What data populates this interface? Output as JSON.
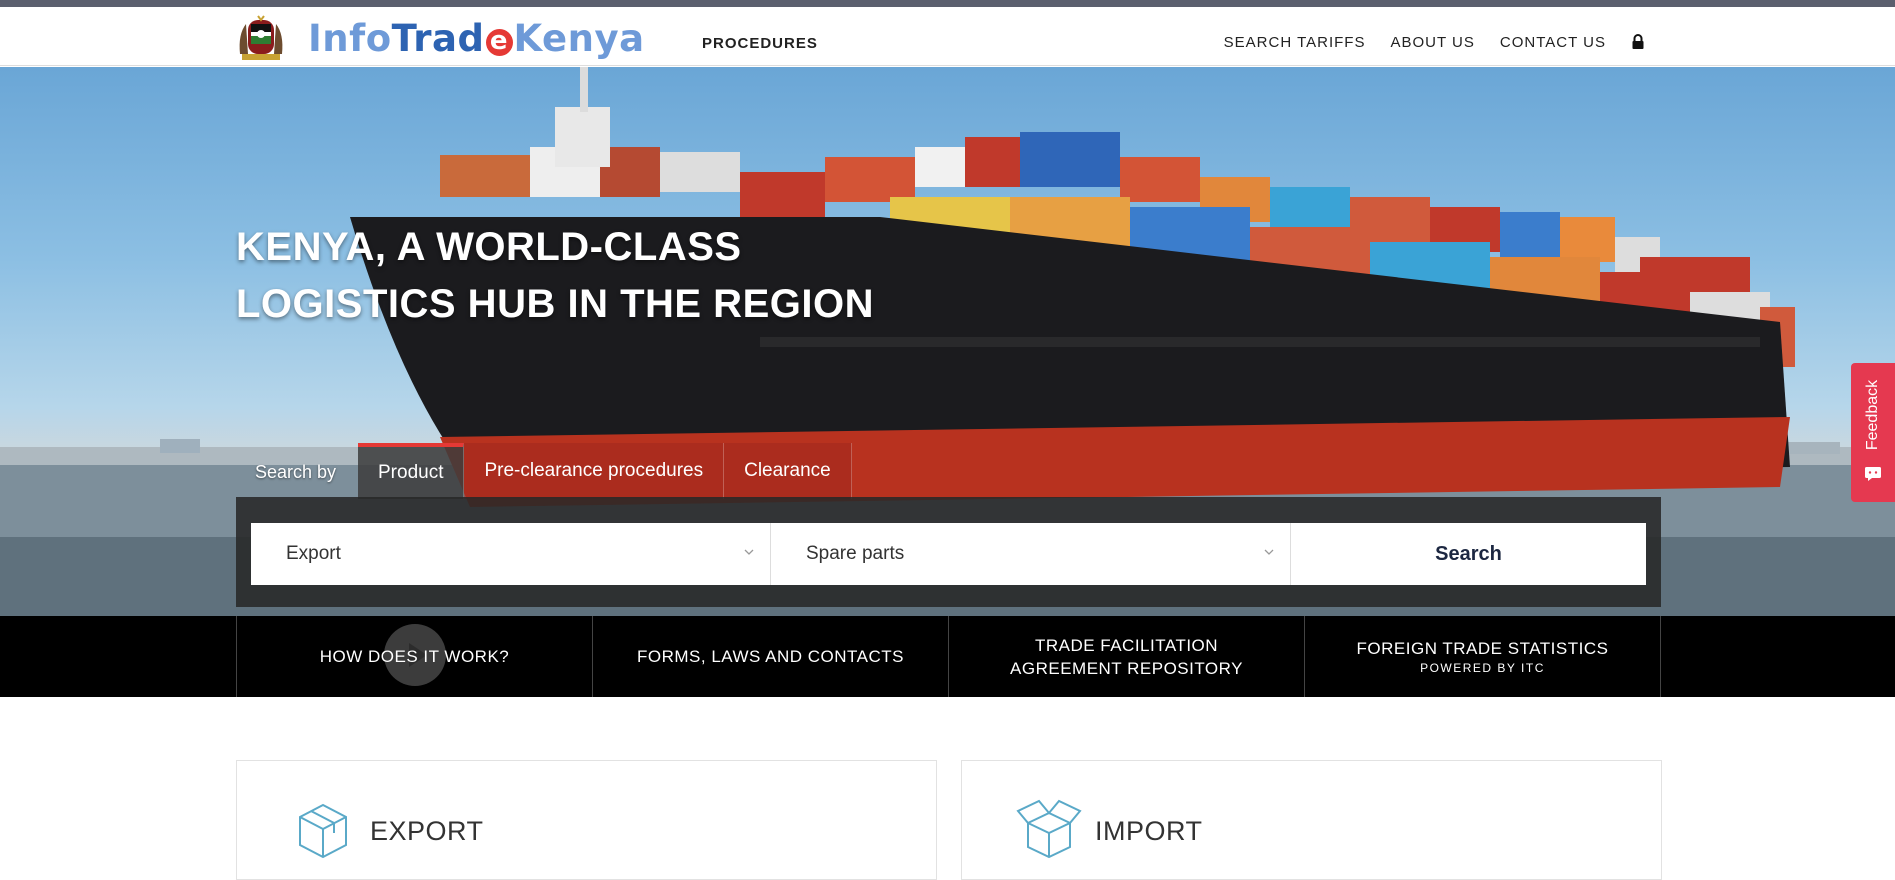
{
  "header": {
    "logo": {
      "part1": "Info",
      "part2": "Trad",
      "part3": "e",
      "part4": "Kenya"
    },
    "nav_left": "PROCEDURES",
    "nav_right": [
      "SEARCH TARIFFS",
      "ABOUT US",
      "CONTACT US"
    ]
  },
  "hero": {
    "headline_line1": "KENYA, A WORLD-CLASS",
    "headline_line2": "LOGISTICS HUB IN THE REGION",
    "search_by_label": "Search by",
    "tabs": [
      {
        "label": "Product",
        "active": true
      },
      {
        "label": "Pre-clearance procedures",
        "active": false
      },
      {
        "label": "Clearance",
        "active": false
      }
    ],
    "flow_select": "Export",
    "product_select": "Spare parts",
    "search_button": "Search"
  },
  "quick_links": {
    "how": "HOW DOES IT WORK?",
    "forms": "FORMS, LAWS AND CONTACTS",
    "tfa_line1": "TRADE FACILITATION",
    "tfa_line2": "AGREEMENT REPOSITORY",
    "stats": "FOREIGN TRADE STATISTICS",
    "stats_sub": "POWERED BY ITC"
  },
  "cards": {
    "export_title": "EXPORT",
    "import_title": "IMPORT"
  },
  "feedback": {
    "label": "Feedback"
  },
  "colors": {
    "accent_red": "#e53935",
    "brand_blue": "#2d63b2",
    "feedback_pink": "#e53950"
  }
}
